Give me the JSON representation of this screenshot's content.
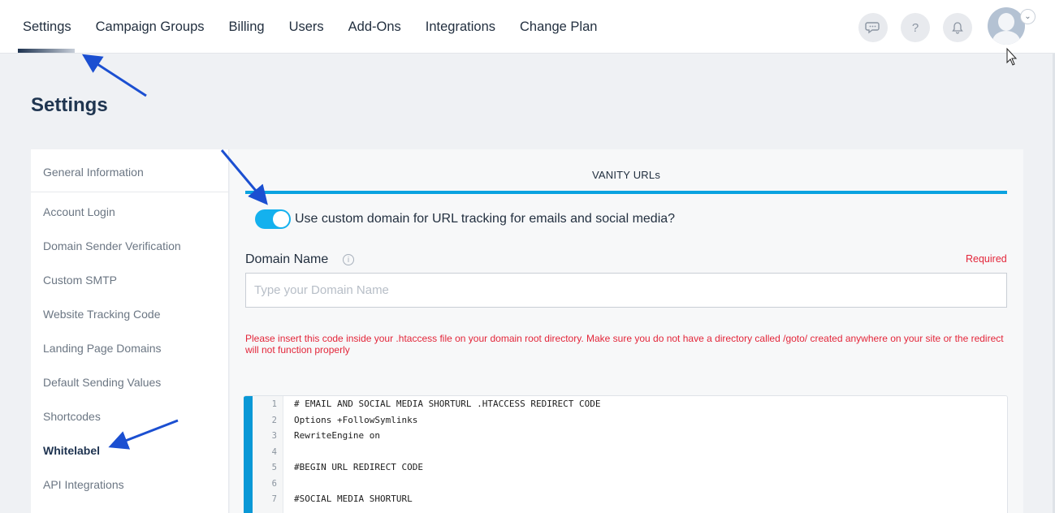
{
  "nav": {
    "items": [
      "Settings",
      "Campaign Groups",
      "Billing",
      "Users",
      "Add-Ons",
      "Integrations",
      "Change Plan"
    ],
    "icons": [
      "chat-icon",
      "help-icon",
      "bell-icon"
    ],
    "help_glyph": "?",
    "avatar_caret": "⌄"
  },
  "page": {
    "title": "Settings"
  },
  "sidebar": {
    "items": [
      "General Information",
      "Account Login",
      "Domain Sender Verification",
      "Custom SMTP",
      "Website Tracking Code",
      "Landing Page Domains",
      "Default Sending Values",
      "Shortcodes",
      "Whitelabel",
      "API Integrations"
    ],
    "active": "Whitelabel"
  },
  "panel": {
    "title": "VANITY URLs",
    "toggle": {
      "on": true,
      "label": "Use custom domain for URL tracking for emails and social media?"
    },
    "domain": {
      "label": "Domain Name",
      "info_glyph": "i",
      "required": "Required",
      "placeholder": "Type your Domain Name",
      "value": ""
    },
    "warning": "Please insert this code inside your .htaccess file on your domain root directory. Make sure you do not have a directory called /goto/ created anywhere on your site or the redirect will not function properly",
    "code": [
      {
        "n": "1",
        "text": "# EMAIL AND SOCIAL MEDIA SHORTURL .HTACCESS REDIRECT CODE"
      },
      {
        "n": "2",
        "text": "Options +FollowSymlinks"
      },
      {
        "n": "3",
        "text": "RewriteEngine on"
      },
      {
        "n": "4",
        "text": ""
      },
      {
        "n": "5",
        "text": "#BEGIN URL REDIRECT CODE"
      },
      {
        "n": "6",
        "text": ""
      },
      {
        "n": "7",
        "text": "#SOCIAL MEDIA SHORTURL"
      }
    ]
  },
  "colors": {
    "accent": "#0aa2e0",
    "toggle": "#14b1ee",
    "required": "#e3263a",
    "annotation_arrow": "#1b4fd1",
    "brand_dark": "#1e3350"
  }
}
